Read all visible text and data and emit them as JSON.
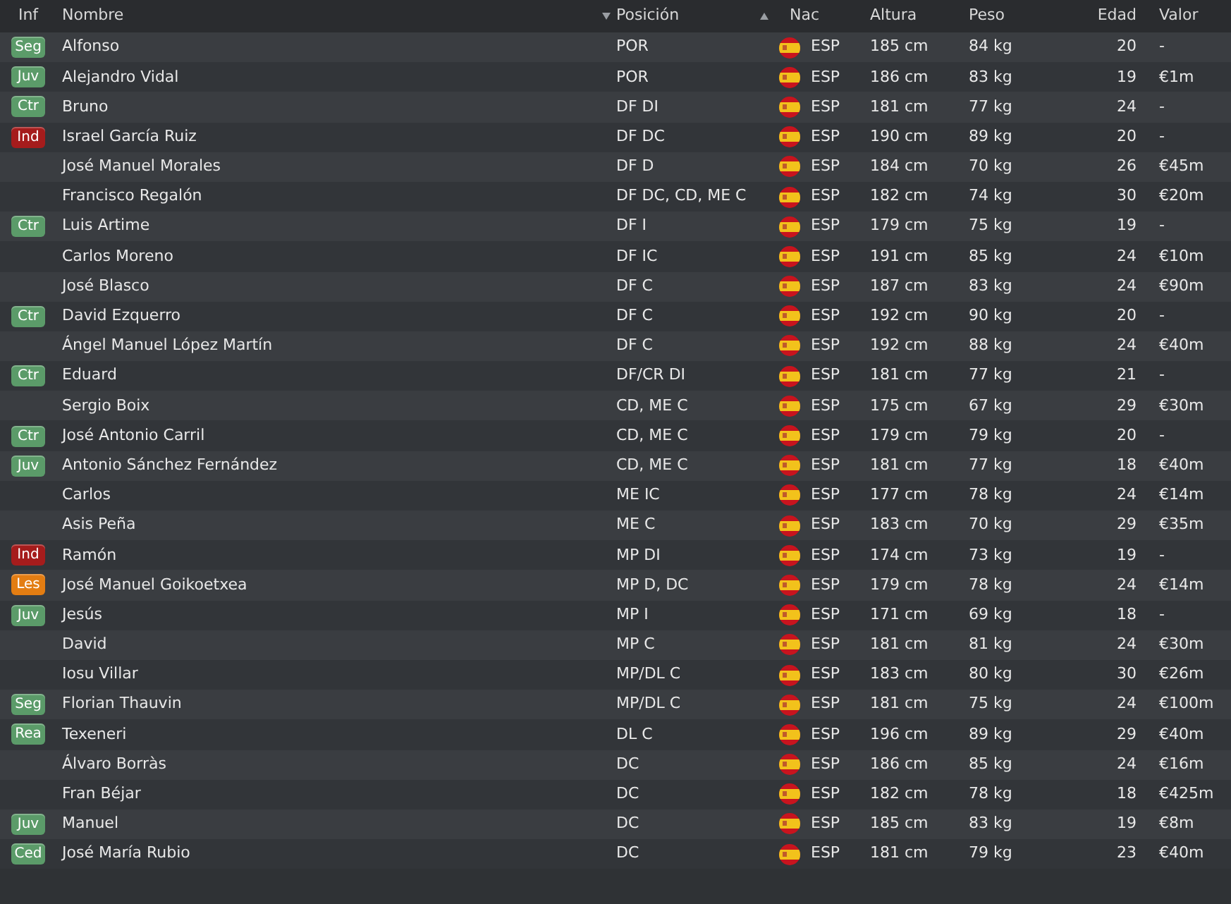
{
  "columns": [
    "Inf",
    "Nombre",
    "Posición",
    "Nac",
    "Altura",
    "Peso",
    "Edad",
    "Valor"
  ],
  "rows": [
    {
      "badge": {
        "label": "Seg",
        "color": "#5b9b69"
      },
      "name": "Alfonso",
      "position": "POR",
      "nation": "ESP",
      "height": "185 cm",
      "weight": "84 kg",
      "age": "20",
      "value": "-"
    },
    {
      "badge": {
        "label": "Juv",
        "color": "#5b9b69"
      },
      "name": "Alejandro Vidal",
      "position": "POR",
      "nation": "ESP",
      "height": "186 cm",
      "weight": "83 kg",
      "age": "19",
      "value": "€1m"
    },
    {
      "badge": {
        "label": "Ctr",
        "color": "#5b9b69"
      },
      "name": "Bruno",
      "position": "DF DI",
      "nation": "ESP",
      "height": "181 cm",
      "weight": "77 kg",
      "age": "24",
      "value": "-"
    },
    {
      "badge": {
        "label": "Ind",
        "color": "#a51c1c"
      },
      "name": "Israel García Ruiz",
      "position": "DF DC",
      "nation": "ESP",
      "height": "190 cm",
      "weight": "89 kg",
      "age": "20",
      "value": "-"
    },
    {
      "name": "José Manuel Morales",
      "position": "DF D",
      "nation": "ESP",
      "height": "184 cm",
      "weight": "70 kg",
      "age": "26",
      "value": "€45m"
    },
    {
      "name": "Francisco Regalón",
      "position": "DF DC, CD, ME C",
      "nation": "ESP",
      "height": "182 cm",
      "weight": "74 kg",
      "age": "30",
      "value": "€20m"
    },
    {
      "badge": {
        "label": "Ctr",
        "color": "#5b9b69"
      },
      "name": "Luis Artime",
      "position": "DF I",
      "nation": "ESP",
      "height": "179 cm",
      "weight": "75 kg",
      "age": "19",
      "value": "-"
    },
    {
      "name": "Carlos Moreno",
      "position": "DF IC",
      "nation": "ESP",
      "height": "191 cm",
      "weight": "85 kg",
      "age": "24",
      "value": "€10m"
    },
    {
      "name": "José Blasco",
      "position": "DF C",
      "nation": "ESP",
      "height": "187 cm",
      "weight": "83 kg",
      "age": "24",
      "value": "€90m"
    },
    {
      "badge": {
        "label": "Ctr",
        "color": "#5b9b69"
      },
      "name": "David Ezquerro",
      "position": "DF C",
      "nation": "ESP",
      "height": "192 cm",
      "weight": "90 kg",
      "age": "20",
      "value": "-"
    },
    {
      "name": "Ángel Manuel López Martín",
      "position": "DF C",
      "nation": "ESP",
      "height": "192 cm",
      "weight": "88 kg",
      "age": "24",
      "value": "€40m"
    },
    {
      "badge": {
        "label": "Ctr",
        "color": "#5b9b69"
      },
      "name": "Eduard",
      "position": "DF/CR DI",
      "nation": "ESP",
      "height": "181 cm",
      "weight": "77 kg",
      "age": "21",
      "value": "-"
    },
    {
      "name": "Sergio Boix",
      "position": "CD, ME C",
      "nation": "ESP",
      "height": "175 cm",
      "weight": "67 kg",
      "age": "29",
      "value": "€30m"
    },
    {
      "badge": {
        "label": "Ctr",
        "color": "#5b9b69"
      },
      "name": "José Antonio Carril",
      "position": "CD, ME C",
      "nation": "ESP",
      "height": "179 cm",
      "weight": "79 kg",
      "age": "20",
      "value": "-"
    },
    {
      "badge": {
        "label": "Juv",
        "color": "#5b9b69"
      },
      "name": "Antonio Sánchez Fernández",
      "position": "CD, ME C",
      "nation": "ESP",
      "height": "181 cm",
      "weight": "77 kg",
      "age": "18",
      "value": "€40m"
    },
    {
      "name": "Carlos",
      "position": "ME IC",
      "nation": "ESP",
      "height": "177 cm",
      "weight": "78 kg",
      "age": "24",
      "value": "€14m"
    },
    {
      "name": "Asis Peña",
      "position": "ME C",
      "nation": "ESP",
      "height": "183 cm",
      "weight": "70 kg",
      "age": "29",
      "value": "€35m"
    },
    {
      "badge": {
        "label": "Ind",
        "color": "#a51c1c"
      },
      "name": "Ramón",
      "position": "MP DI",
      "nation": "ESP",
      "height": "174 cm",
      "weight": "73 kg",
      "age": "19",
      "value": "-"
    },
    {
      "badge": {
        "label": "Les",
        "color": "#e37d12"
      },
      "name": "José Manuel Goikoetxea",
      "position": "MP D, DC",
      "nation": "ESP",
      "height": "179 cm",
      "weight": "78 kg",
      "age": "24",
      "value": "€14m"
    },
    {
      "badge": {
        "label": "Juv",
        "color": "#5b9b69"
      },
      "name": "Jesús",
      "position": "MP I",
      "nation": "ESP",
      "height": "171 cm",
      "weight": "69 kg",
      "age": "18",
      "value": "-"
    },
    {
      "name": "David",
      "position": "MP C",
      "nation": "ESP",
      "height": "181 cm",
      "weight": "81 kg",
      "age": "24",
      "value": "€30m"
    },
    {
      "name": "Iosu Villar",
      "position": "MP/DL C",
      "nation": "ESP",
      "height": "183 cm",
      "weight": "80 kg",
      "age": "30",
      "value": "€26m"
    },
    {
      "badge": {
        "label": "Seg",
        "color": "#5b9b69"
      },
      "name": "Florian Thauvin",
      "position": "MP/DL C",
      "nation": "ESP",
      "height": "181 cm",
      "weight": "75 kg",
      "age": "24",
      "value": "€100m"
    },
    {
      "badge": {
        "label": "Rea",
        "color": "#5b9b69"
      },
      "name": "Texeneri",
      "position": "DL C",
      "nation": "ESP",
      "height": "196 cm",
      "weight": "89 kg",
      "age": "29",
      "value": "€40m"
    },
    {
      "name": "Álvaro Borràs",
      "position": "DC",
      "nation": "ESP",
      "height": "186 cm",
      "weight": "85 kg",
      "age": "24",
      "value": "€16m"
    },
    {
      "name": "Fran Béjar",
      "position": "DC",
      "nation": "ESP",
      "height": "182 cm",
      "weight": "78 kg",
      "age": "18",
      "value": "€425m"
    },
    {
      "badge": {
        "label": "Juv",
        "color": "#5b9b69"
      },
      "name": "Manuel",
      "position": "DC",
      "nation": "ESP",
      "height": "185 cm",
      "weight": "83 kg",
      "age": "19",
      "value": "€8m"
    },
    {
      "badge": {
        "label": "Ced",
        "color": "#5b9b69"
      },
      "name": "José María Rubio",
      "position": "DC",
      "nation": "ESP",
      "height": "181 cm",
      "weight": "79 kg",
      "age": "23",
      "value": "€40m"
    }
  ]
}
